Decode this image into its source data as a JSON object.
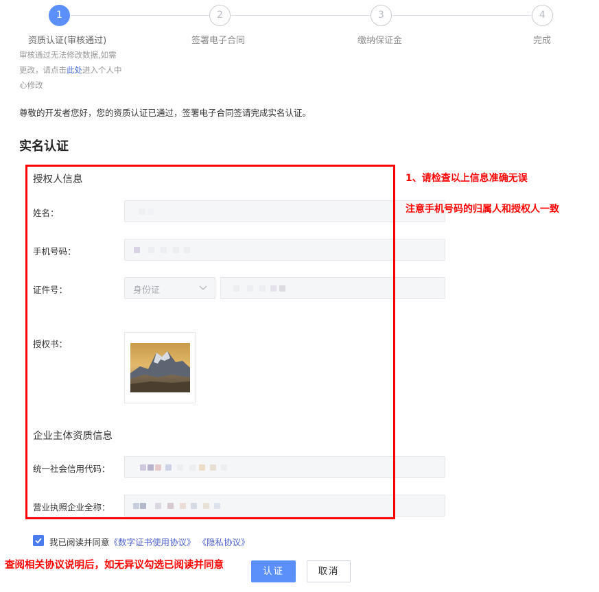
{
  "steps": [
    {
      "number": "1",
      "title": "资质认证(审核通过)",
      "status": "active"
    },
    {
      "number": "2",
      "title": "签署电子合同",
      "status": "inactive"
    },
    {
      "number": "3",
      "title": "缴纳保证金",
      "status": "inactive"
    },
    {
      "number": "4",
      "title": "完成",
      "status": "inactive"
    }
  ],
  "step_desc": {
    "before": "审核通过无法修改数据,如需更改，请点击",
    "link": "此处",
    "after": "进入个人中心修改"
  },
  "greeting": "尊敬的开发者您好，您的资质认证已通过，签署电子合同签请完成实名认证。",
  "page_title": "实名认证",
  "authorizer": {
    "section_title": "授权人信息",
    "name_label": "姓名：",
    "phone_label": "手机号码：",
    "id_label": "证件号：",
    "id_type": "身份证",
    "letter_label": "授权书："
  },
  "enterprise": {
    "section_title": "企业主体资质信息",
    "credit_code_label": "统一社会信用代码：",
    "company_name_label": "营业执照企业全称："
  },
  "notes": {
    "note1": "1、请检查以上信息准确无误",
    "note2": "注意手机号码的归属人和授权人一致",
    "note3": "查阅相关协议说明后，如无异议勾选已阅读并同意"
  },
  "agreement": {
    "checked": true,
    "prefix": "我已阅读并同意",
    "link1": "《数字证书使用协议》",
    "link2": "《隐私协议》"
  },
  "buttons": {
    "submit": "认证",
    "cancel": "取消"
  },
  "colors": {
    "primary": "#5b8ff9",
    "highlight": "#ff0000",
    "link": "#4a5fd0"
  }
}
